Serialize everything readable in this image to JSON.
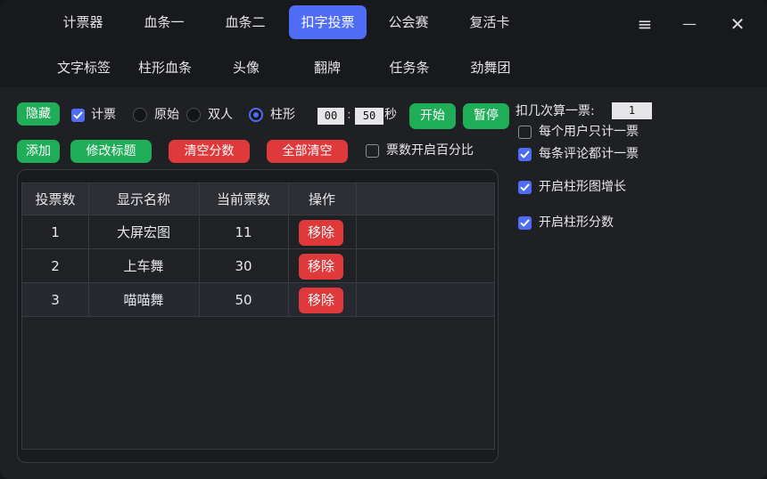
{
  "tabs_row1": [
    "计票器",
    "血条一",
    "血条二",
    "扣字投票",
    "公会赛",
    "复活卡"
  ],
  "tabs_row2": [
    "文字标签",
    "柱形血条",
    "头像",
    "翻牌",
    "任务条",
    "劲舞团"
  ],
  "active_tab": "扣字投票",
  "window_controls": {
    "menu": "≡",
    "minimize": "—",
    "close": "✕"
  },
  "toolbar": {
    "hide_label": "隐藏",
    "count_label": "计票",
    "mode_original": "原始",
    "mode_double": "双人",
    "mode_bar": "柱形",
    "timer_min": "00",
    "timer_sep": ":",
    "timer_sec": "50",
    "sec_unit": "秒",
    "start_label": "开始",
    "pause_label": "暂停",
    "add_label": "添加",
    "edit_title_label": "修改标题",
    "clear_score_label": "清空分数",
    "clear_all_label": "全部清空",
    "percent_label": "票数开启百分比"
  },
  "settings": {
    "per_vote_label": "扣几次算一票:",
    "per_vote_value": "1",
    "per_user_label": "每个用户只计一票",
    "per_comment_label": "每条评论都计一票",
    "bar_growth_label": "开启柱形图增长",
    "bar_score_label": "开启柱形分数"
  },
  "table": {
    "headers": [
      "投票数",
      "显示名称",
      "当前票数",
      "操作"
    ],
    "remove_label": "移除",
    "rows": [
      {
        "id": "1",
        "name": "大屏宏图",
        "votes": "11"
      },
      {
        "id": "2",
        "name": "上车舞",
        "votes": "30"
      },
      {
        "id": "3",
        "name": "喵喵舞",
        "votes": "50"
      }
    ]
  },
  "colors": {
    "accent": "#4f6cf5",
    "green": "#1fae57",
    "red": "#e0393b",
    "bg": "#1f2024"
  }
}
